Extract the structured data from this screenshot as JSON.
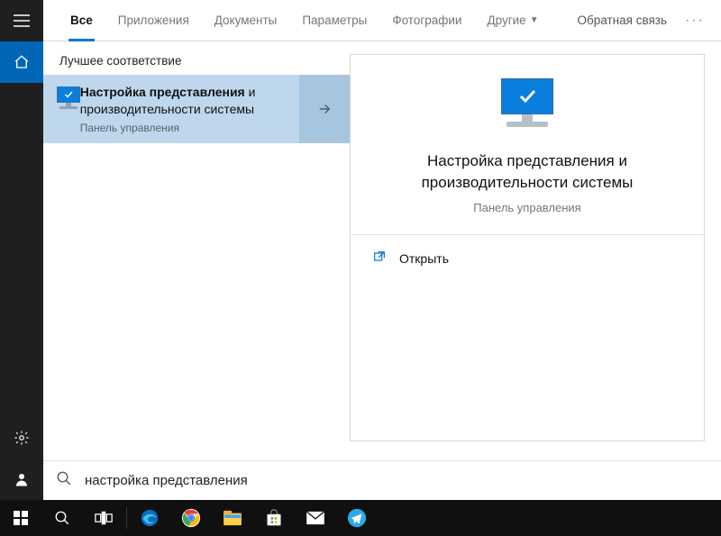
{
  "tabs": {
    "all": "Все",
    "apps": "Приложения",
    "documents": "Документы",
    "settings": "Параметры",
    "photos": "Фотографии",
    "more": "Другие"
  },
  "feedback": "Обратная связь",
  "section_best_match": "Лучшее соответствие",
  "result": {
    "title_bold": "Настройка представления",
    "title_rest": " и производительности системы",
    "subtitle": "Панель управления"
  },
  "preview": {
    "title": "Настройка представления и производительности системы",
    "subtitle": "Панель управления",
    "open": "Открыть"
  },
  "search": {
    "query": "настройка представления"
  }
}
